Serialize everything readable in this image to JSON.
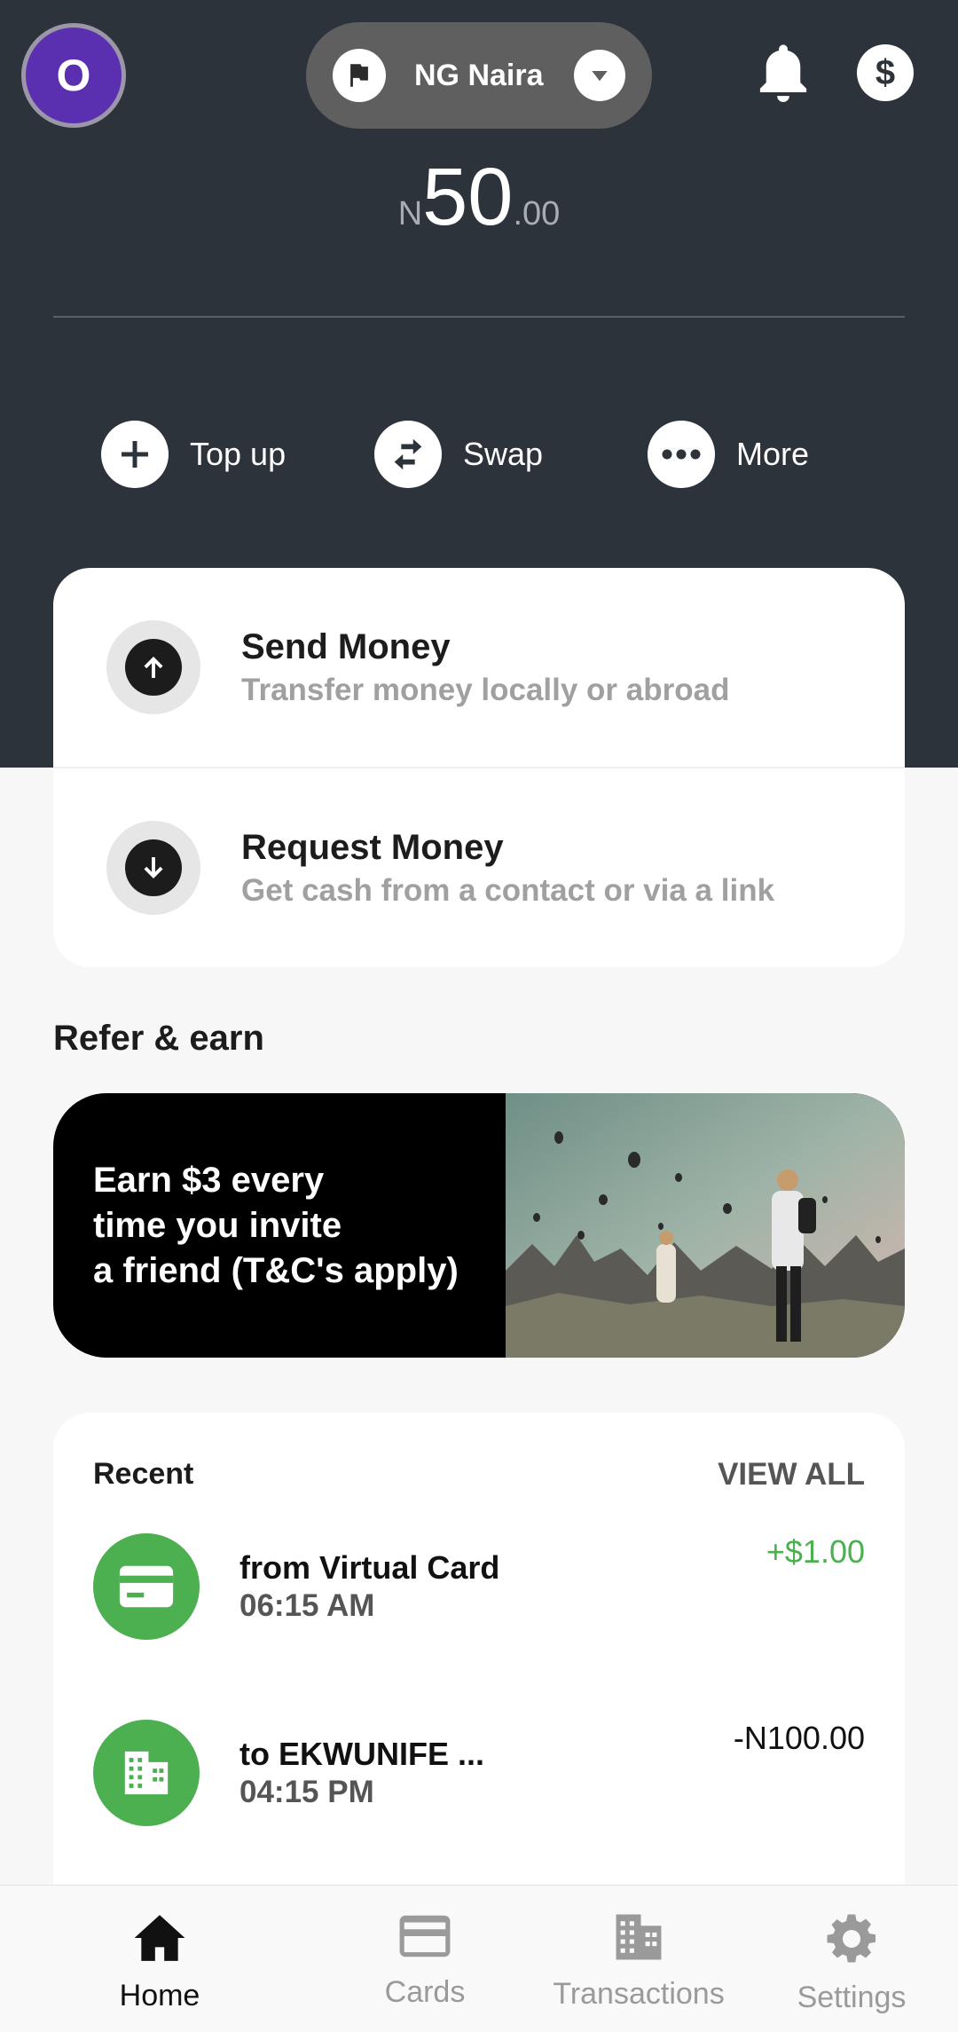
{
  "header": {
    "avatar_initial": "O",
    "currency_label": "NG Naira",
    "icons": [
      "flag-icon",
      "chevron-down-icon",
      "bell-icon",
      "dollar-icon"
    ]
  },
  "balance": {
    "currency_symbol": "N",
    "integer": "50",
    "decimal": ".00"
  },
  "actions": [
    {
      "label": "Top up",
      "icon": "plus-icon"
    },
    {
      "label": "Swap",
      "icon": "swap-icon"
    },
    {
      "label": "More",
      "icon": "more-icon"
    }
  ],
  "money": {
    "send_title": "Send Money",
    "send_sub": "Transfer money locally or abroad",
    "request_title": "Request Money",
    "request_sub": "Get cash from a contact or via a link"
  },
  "refer": {
    "section_title": "Refer & earn",
    "line1": "Earn $3 every",
    "line2": "time you invite",
    "line3": "a friend (T&C's apply)"
  },
  "recent": {
    "title": "Recent",
    "view_all": "VIEW ALL",
    "items": [
      {
        "name": "from Virtual Card",
        "time": "06:15 AM",
        "amount": "+$1.00",
        "icon": "card-icon"
      },
      {
        "name": "to EKWUNIFE ...",
        "time": "04:15 PM",
        "amount": "-N100.00",
        "icon": "building-icon"
      }
    ]
  },
  "nav": {
    "items": [
      {
        "label": "Home",
        "icon": "home-icon"
      },
      {
        "label": "Cards",
        "icon": "card-icon"
      },
      {
        "label": "Transactions",
        "icon": "building-icon"
      },
      {
        "label": "Settings",
        "icon": "gear-icon"
      }
    ]
  },
  "colors": {
    "header_bg": "#2c333a",
    "accent_green": "#4caf50",
    "avatar_purple": "#5a2fb0",
    "positive_amount": "#4caf50"
  }
}
